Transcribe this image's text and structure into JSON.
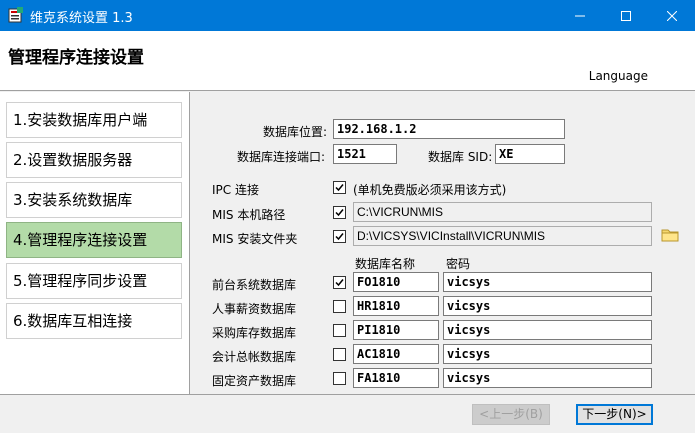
{
  "window": {
    "title": "维克系统设置 1.3",
    "minimize_glyph": "—",
    "maximize_glyph": "☐",
    "close_glyph": "✕"
  },
  "header": {
    "title": "管理程序连接设置",
    "language": "Language"
  },
  "sidebar": {
    "items": [
      {
        "label": "1.安装数据库用户端",
        "active": false
      },
      {
        "label": "2.设置数据服务器",
        "active": false
      },
      {
        "label": "3.安装系统数据库",
        "active": false
      },
      {
        "label": "4.管理程序连接设置",
        "active": true
      },
      {
        "label": "5.管理程序同步设置",
        "active": false
      },
      {
        "label": "6.数据库互相连接",
        "active": false
      }
    ]
  },
  "connection": {
    "db_location_label": "数据库位置:",
    "db_location_value": "192.168.1.2",
    "port_label": "数据库连接端口:",
    "port_value": "1521",
    "sid_label": "数据库 SID:",
    "sid_value": "XE"
  },
  "options": {
    "ipc_label": "IPC 连接",
    "ipc_note": "(单机免费版必须采用该方式)",
    "ipc_checked": true,
    "mis_path_label": "MIS 本机路径",
    "mis_path_value": "C:\\VICRUN\\MIS",
    "mis_path_checked": true,
    "mis_install_label": "MIS 安装文件夹",
    "mis_install_value": "D:\\VICSYS\\VICInstall\\VICRUN\\MIS",
    "mis_install_checked": true,
    "folder_icon": "folder-icon"
  },
  "databases": {
    "name_header": "数据库名称",
    "password_header": "密码",
    "rows": [
      {
        "label": "前台系统数据库",
        "checked": true,
        "name": "FO1810",
        "password": "vicsys"
      },
      {
        "label": "人事薪资数据库",
        "checked": false,
        "name": "HR1810",
        "password": "vicsys"
      },
      {
        "label": "采购库存数据库",
        "checked": false,
        "name": "PI1810",
        "password": "vicsys"
      },
      {
        "label": "会计总帐数据库",
        "checked": false,
        "name": "AC1810",
        "password": "vicsys"
      },
      {
        "label": "固定资产数据库",
        "checked": false,
        "name": "FA1810",
        "password": "vicsys"
      }
    ]
  },
  "footer": {
    "prev_label": "<上一步(B)",
    "next_label": "下一步(N)>"
  },
  "colors": {
    "titlebar": "#0078d7",
    "active_step": "#b3dba8"
  }
}
